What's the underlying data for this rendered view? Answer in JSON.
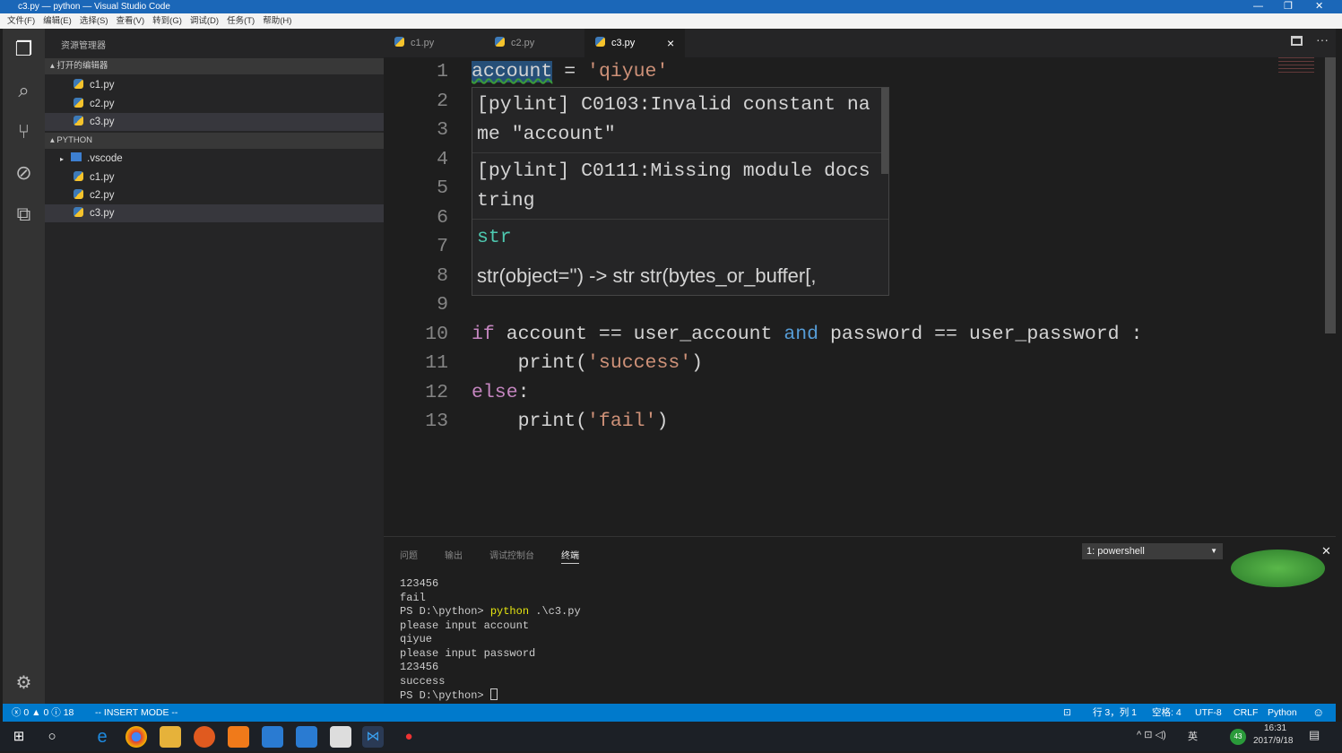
{
  "window": {
    "title": "c3.py — python — Visual Studio Code",
    "minimize": "—",
    "restore": "❐",
    "close": "✕"
  },
  "menu": [
    "文件(F)",
    "编辑(E)",
    "选择(S)",
    "查看(V)",
    "转到(G)",
    "调试(D)",
    "任务(T)",
    "帮助(H)"
  ],
  "sidebar": {
    "title": "资源管理器",
    "open_editors_label": "打开的编辑器",
    "open_editors": [
      "c1.py",
      "c2.py",
      "c3.py"
    ],
    "folder_label": "PYTHON",
    "folder_items": [
      ".vscode",
      "c1.py",
      "c2.py",
      "c3.py"
    ]
  },
  "tabs": [
    {
      "label": "c1.py"
    },
    {
      "label": "c2.py"
    },
    {
      "label": "c3.py",
      "active": true,
      "close": "×"
    }
  ],
  "editor": {
    "line_numbers": [
      "1",
      "2",
      "3",
      "4",
      "5",
      "6",
      "7",
      "8",
      "9",
      "10",
      "11",
      "12",
      "13"
    ],
    "lines": [
      {
        "n": 1,
        "tokens": [
          [
            "account",
            "var"
          ],
          [
            " = ",
            ""
          ],
          [
            "'qiyue'",
            "str"
          ]
        ]
      },
      {
        "n": 10,
        "tokens": [
          [
            "if",
            "kw"
          ],
          [
            " account == user_account ",
            ""
          ],
          [
            "and",
            "op"
          ],
          [
            " password == user_password :",
            ""
          ]
        ]
      },
      {
        "n": 11,
        "tokens": [
          [
            "    print(",
            ""
          ],
          [
            "'success'",
            "str"
          ],
          [
            ")",
            ""
          ]
        ]
      },
      {
        "n": 12,
        "tokens": [
          [
            "else",
            "kw"
          ],
          [
            ":",
            ""
          ]
        ]
      },
      {
        "n": 13,
        "tokens": [
          [
            "    print(",
            ""
          ],
          [
            "'fail'",
            "str"
          ],
          [
            ")",
            ""
          ]
        ]
      }
    ]
  },
  "hover": {
    "msg1a": "[pylint] C0103:Invalid constant na",
    "msg1b": "me \"account\"",
    "msg2a": "[pylint] C0111:Missing module docs",
    "msg2b": "tring",
    "type": "str",
    "signature": "str(object='') -> str str(bytes_or_buffer[,"
  },
  "panel": {
    "tabs": [
      "问题",
      "输出",
      "调试控制台",
      "终端"
    ],
    "active_tab": "终端",
    "terminal_select": "1: powershell",
    "terminal_lines": [
      "123456",
      "fail",
      "PS D:\\python> |python| .\\c3.py",
      "please input account",
      "qiyue",
      "please input password",
      "123456",
      "success",
      "PS D:\\python> "
    ]
  },
  "status": {
    "errors": "0",
    "warnings": "0",
    "infos": "18",
    "mode": "-- INSERT MODE --",
    "position": "行 3，列 1",
    "spaces": "空格: 4",
    "encoding": "UTF-8",
    "eol": "CRLF",
    "language": "Python"
  },
  "taskbar": {
    "time": "16:31",
    "date": "2017/9/18",
    "ime": "英",
    "badge": "43"
  },
  "colors": {
    "accent": "#007acc",
    "string": "#ce9178",
    "keyword": "#c586c0",
    "operator": "#569cd6",
    "type": "#4ec9b0"
  }
}
